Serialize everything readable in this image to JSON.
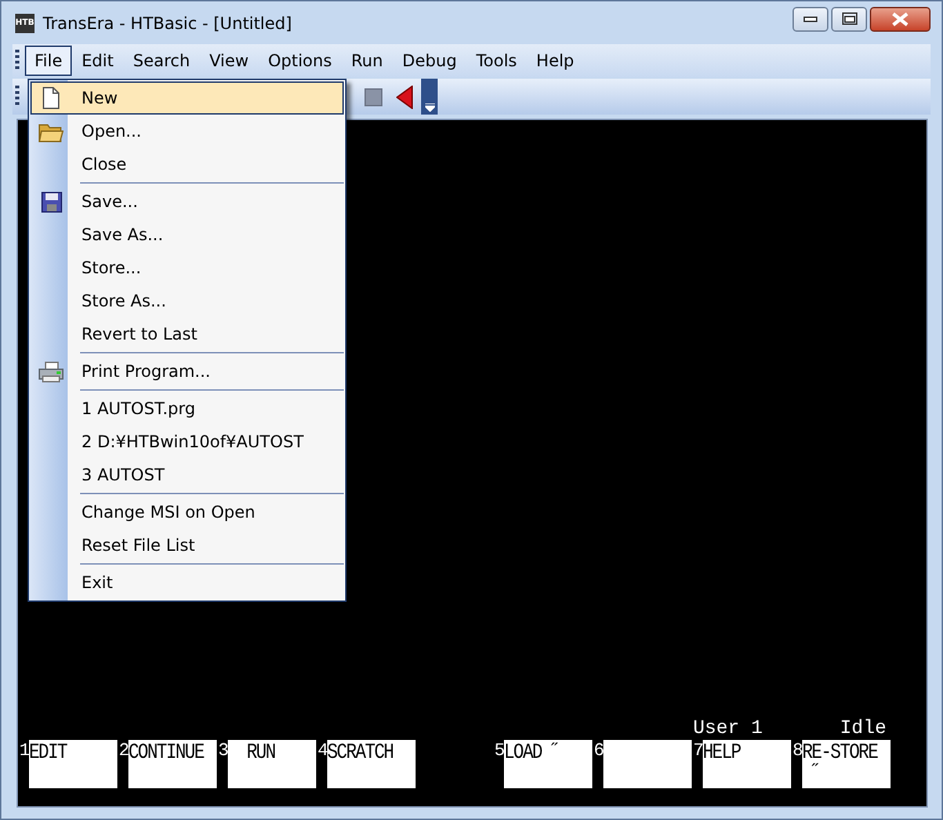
{
  "window": {
    "title": "TransEra - HTBasic - [Untitled]",
    "app_icon_text": "HTB"
  },
  "menubar": [
    {
      "label": "File",
      "selected": true
    },
    {
      "label": "Edit",
      "selected": false
    },
    {
      "label": "Search",
      "selected": false
    },
    {
      "label": "View",
      "selected": false
    },
    {
      "label": "Options",
      "selected": false
    },
    {
      "label": "Run",
      "selected": false
    },
    {
      "label": "Debug",
      "selected": false
    },
    {
      "label": "Tools",
      "selected": false
    },
    {
      "label": "Help",
      "selected": false
    }
  ],
  "file_menu": [
    {
      "kind": "item",
      "label": "New",
      "selected": true
    },
    {
      "kind": "item",
      "label": "Open...",
      "selected": false
    },
    {
      "kind": "item",
      "label": "Close",
      "selected": false
    },
    {
      "kind": "separator"
    },
    {
      "kind": "item",
      "label": "Save...",
      "selected": false
    },
    {
      "kind": "item",
      "label": "Save As...",
      "selected": false
    },
    {
      "kind": "item",
      "label": "Store...",
      "selected": false
    },
    {
      "kind": "item",
      "label": "Store As...",
      "selected": false
    },
    {
      "kind": "item",
      "label": "Revert to Last",
      "selected": false
    },
    {
      "kind": "separator"
    },
    {
      "kind": "item",
      "label": "Print Program...",
      "selected": false
    },
    {
      "kind": "separator"
    },
    {
      "kind": "item",
      "label": "1 AUTOST.prg",
      "selected": false
    },
    {
      "kind": "item",
      "label": "2 D:¥HTBwin10of¥AUTOST",
      "selected": false
    },
    {
      "kind": "item",
      "label": "3 AUTOST",
      "selected": false
    },
    {
      "kind": "separator"
    },
    {
      "kind": "item",
      "label": "Change MSI on Open",
      "selected": false
    },
    {
      "kind": "item",
      "label": "Reset File List",
      "selected": false
    },
    {
      "kind": "separator"
    },
    {
      "kind": "item",
      "label": "Exit",
      "selected": false
    }
  ],
  "status": {
    "user": "User 1",
    "state": "Idle"
  },
  "softkeys": [
    {
      "number": "1",
      "lines": [
        "EDIT"
      ]
    },
    {
      "number": "2",
      "lines": [
        "CONTINUE"
      ]
    },
    {
      "number": "3",
      "lines": [
        "  RUN"
      ]
    },
    {
      "number": "4",
      "lines": [
        "SCRATCH"
      ]
    },
    {
      "number": "5",
      "lines": [
        "LOAD ˝"
      ]
    },
    {
      "number": "6"
    },
    {
      "number": "7",
      "lines": [
        "HELP"
      ]
    },
    {
      "number": "8",
      "lines": [
        "RE-STORE",
        " ˝"
      ]
    }
  ]
}
